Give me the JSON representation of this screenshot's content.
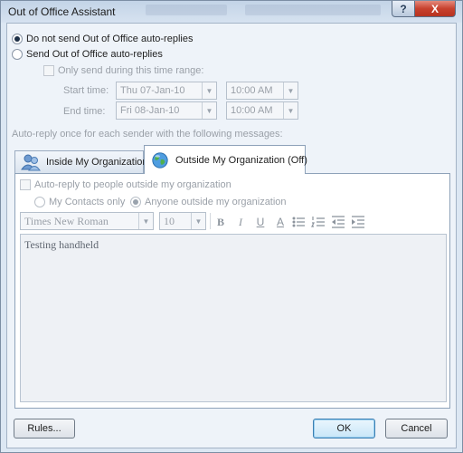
{
  "window": {
    "title": "Out of Office Assistant",
    "help_glyph": "?",
    "close_glyph": "X"
  },
  "status": {
    "do_not_send_label": "Do not send Out of Office auto-replies",
    "send_label": "Send Out of Office auto-replies",
    "selected": "do_not_send"
  },
  "time_range": {
    "checkbox_label": "Only send during this time range:",
    "start_label": "Start time:",
    "end_label": "End time:",
    "start_date": "Thu 07-Jan-10",
    "start_time": "10:00 AM",
    "end_date": "Fri 08-Jan-10",
    "end_time": "10:00 AM"
  },
  "auto_reply_caption": "Auto-reply once for each sender with the following messages:",
  "tabs": {
    "inside": {
      "label": "Inside My Organization",
      "icon": "people-icon"
    },
    "outside": {
      "label": "Outside My Organization (Off)",
      "icon": "globe-icon"
    }
  },
  "outside_panel": {
    "auto_reply_label": "Auto-reply to people outside my organization",
    "contacts_only_label": "My Contacts only",
    "anyone_label": "Anyone outside my organization",
    "selected_audience": "anyone"
  },
  "format_bar": {
    "font": "Times New Roman",
    "size": "10",
    "bold": "B",
    "italic": "I",
    "underline": "U",
    "font_color": "A"
  },
  "message": {
    "text": "Testing handheld"
  },
  "buttons": {
    "rules": "Rules...",
    "ok": "OK",
    "cancel": "Cancel"
  },
  "colors": {
    "window_bg": "#dce7f3",
    "close_red": "#c7412e",
    "default_button_border": "#3c7fb1"
  }
}
